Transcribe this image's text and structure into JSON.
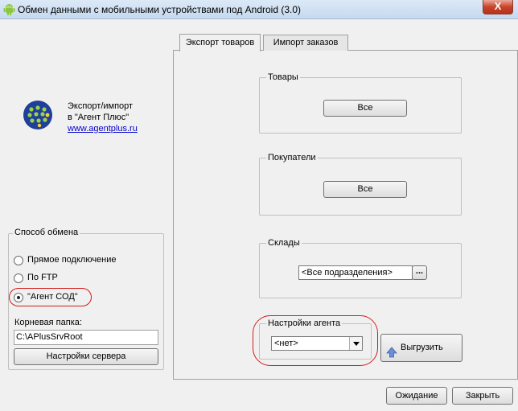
{
  "window": {
    "title": "Обмен данными с мобильными устройствами под Android  (3.0)",
    "close_label": "X"
  },
  "brand": {
    "line1": "Экспорт/импорт",
    "line2": "в \"Агент Плюс\"",
    "link": "www.agentplus.ru"
  },
  "exchange": {
    "legend": "Способ обмена",
    "options": [
      {
        "label": "Прямое подключение",
        "checked": false
      },
      {
        "label": "По FTP",
        "checked": false
      },
      {
        "label": "\"Агент СОД\"",
        "checked": true
      }
    ],
    "root_folder_label": "Корневая папка:",
    "root_folder_value": "C:\\APlusSrvRoot",
    "server_settings_button": "Настройки сервера"
  },
  "tabs": [
    {
      "label": "Экспорт товаров",
      "active": true
    },
    {
      "label": "Импорт заказов",
      "active": false
    }
  ],
  "export": {
    "goods_legend": "Товары",
    "goods_button": "Все",
    "customers_legend": "Покупатели",
    "customers_button": "Все",
    "warehouses_legend": "Склады",
    "warehouses_value": "<Все подразделения>",
    "ellipsis_button": "...",
    "agent_settings_legend": "Настройки агента",
    "agent_value": "<нет>",
    "upload_button": "Выгрузить"
  },
  "footer": {
    "wait_button": "Ожидание",
    "close_button": "Закрыть"
  },
  "colors": {
    "highlight": "#d21c1c",
    "link": "#0000cc",
    "upload_arrow": "#6a8fd8"
  }
}
